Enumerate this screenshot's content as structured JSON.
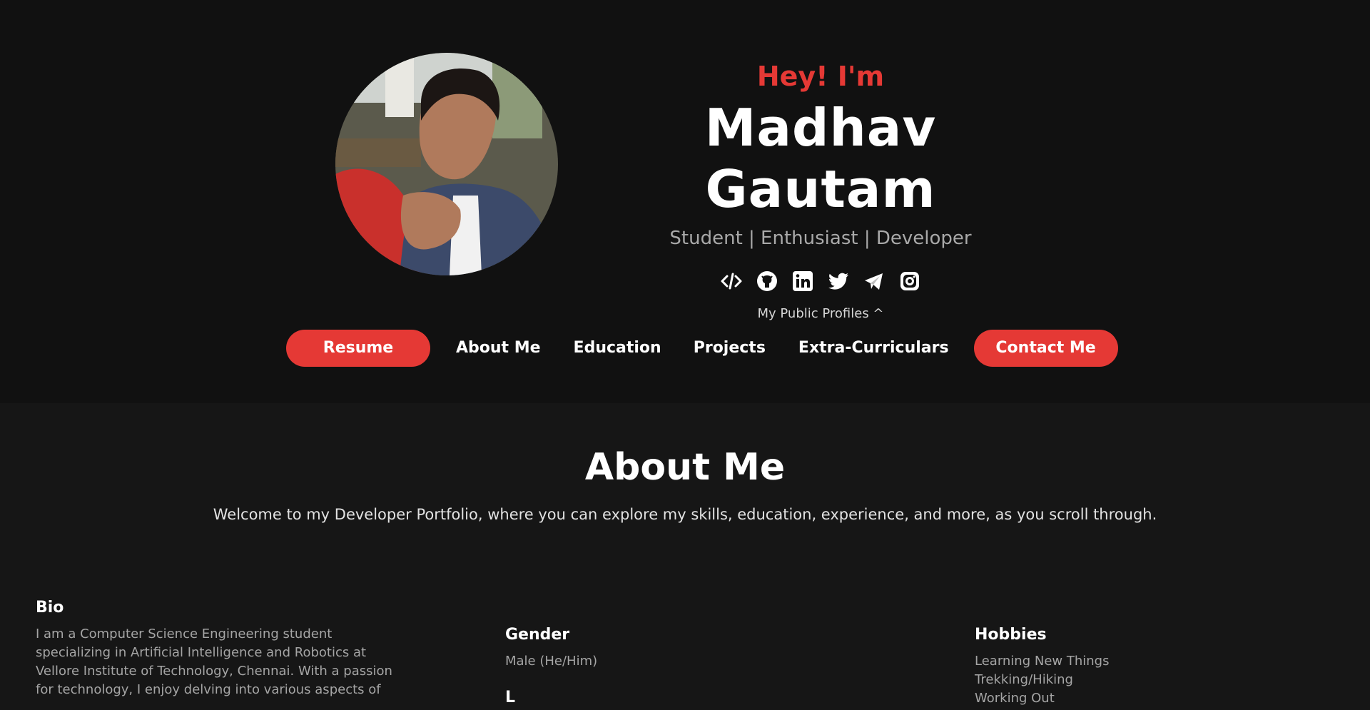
{
  "hero": {
    "greeting": "Hey! I'm",
    "name": "Madhav Gautam",
    "tagline": "Student | Enthusiast | Developer",
    "social_icons": [
      "code-icon",
      "github-icon",
      "linkedin-icon",
      "twitter-icon",
      "telegram-icon",
      "instagram-icon"
    ],
    "profiles_note": "My Public Profiles ^"
  },
  "nav": {
    "resume": "Resume",
    "about": "About Me",
    "education": "Education",
    "projects": "Projects",
    "extra": "Extra-Curriculars",
    "contact": "Contact Me"
  },
  "about": {
    "title": "About Me",
    "lead": "Welcome to my Developer Portfolio, where you can explore my skills, education, experience, and more, as you scroll through.",
    "bio": {
      "heading": "Bio",
      "text": "I am a Computer Science Engineering student specializing in Artificial Intelligence and Robotics at Vellore Institute of Technology, Chennai. With a passion for technology, I enjoy delving into various aspects of"
    },
    "gender": {
      "heading": "Gender",
      "value": "Male (He/Him)",
      "next_heading": "L"
    },
    "hobbies": {
      "heading": "Hobbies",
      "items": [
        "Learning New Things",
        "Trekking/Hiking",
        "Working Out"
      ]
    }
  },
  "colors": {
    "accent": "#e53935",
    "hero_bg": "#111111",
    "section_bg": "#161616"
  }
}
